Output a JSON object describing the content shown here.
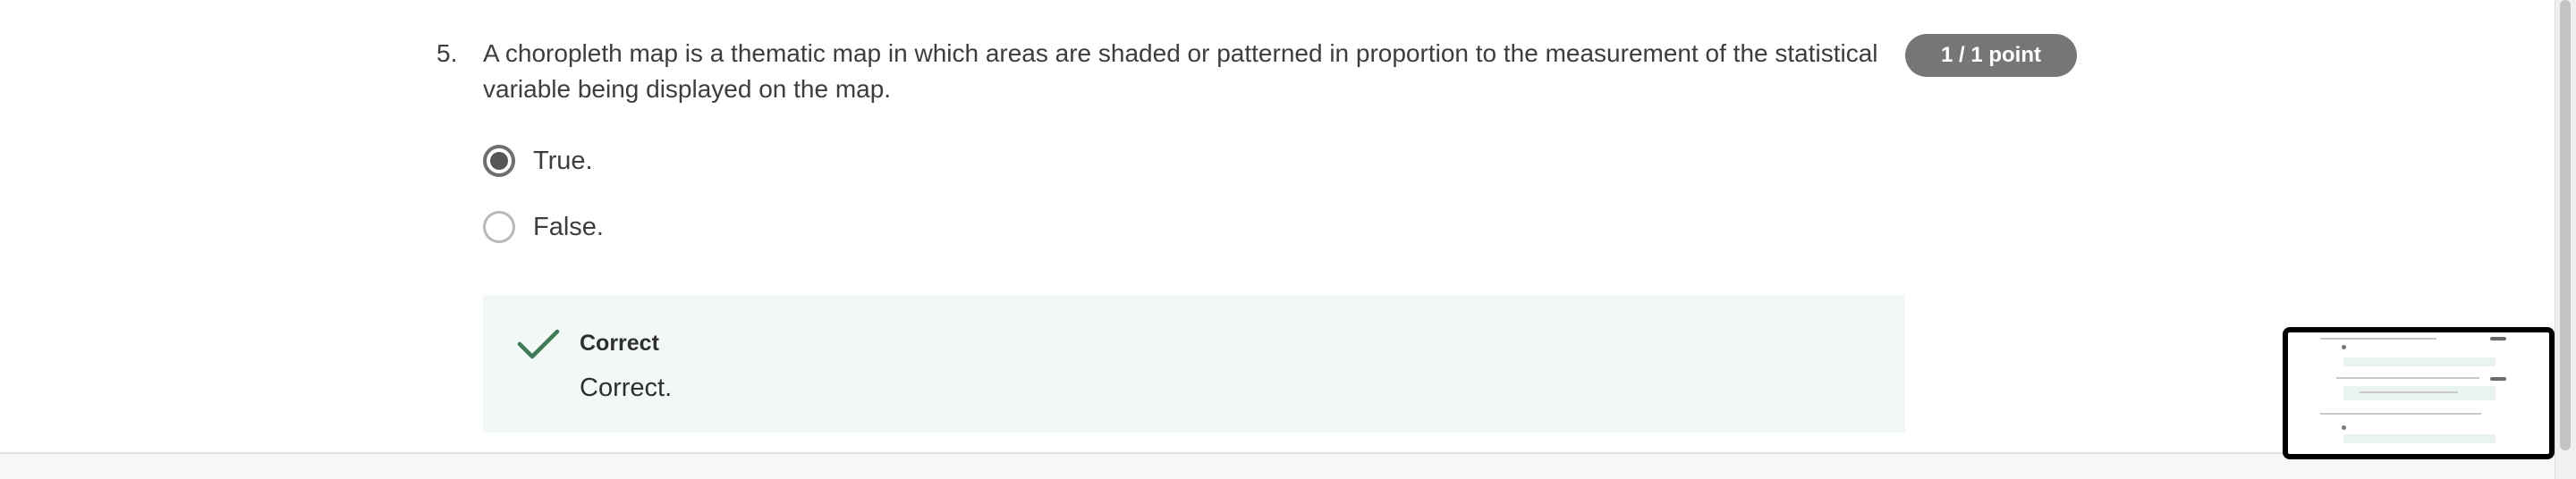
{
  "question": {
    "number": "5.",
    "text": "A choropleth map is a thematic map in which areas are shaded or patterned in proportion to the measurement of the statistical variable being displayed on the map.",
    "points": "1 / 1 point",
    "options": [
      {
        "label": "True.",
        "selected": true
      },
      {
        "label": "False.",
        "selected": false
      }
    ]
  },
  "feedback": {
    "title": "Correct",
    "text": "Correct.",
    "icon": "checkmark-icon",
    "accent_color": "#3d7a56",
    "background_color": "#f1f8f6"
  },
  "colors": {
    "badge": "#767676",
    "text": "#3d3d3d"
  }
}
